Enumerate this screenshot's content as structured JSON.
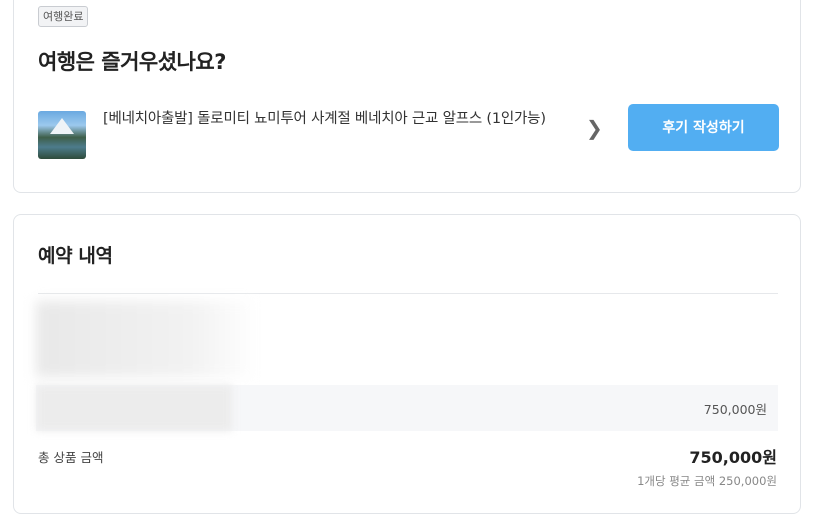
{
  "trip_card": {
    "status_badge": "여행완료",
    "headline": "여행은 즐거우셨나요?",
    "product_title": "[베네치아출발] 돌로미티 뇨미투어 사계절 베네치아 근교 알프스 (1인가능)",
    "chevron_icon": "chevron-right-icon",
    "review_button": "후기 작성하기",
    "accent_color": "#52aef2"
  },
  "reservation": {
    "section_title": "예약 내역",
    "option_price": "750,000원",
    "total_label": "총 상품 금액",
    "total_value": "750,000원",
    "average_price": "1개당 평균 금액 250,000원"
  }
}
